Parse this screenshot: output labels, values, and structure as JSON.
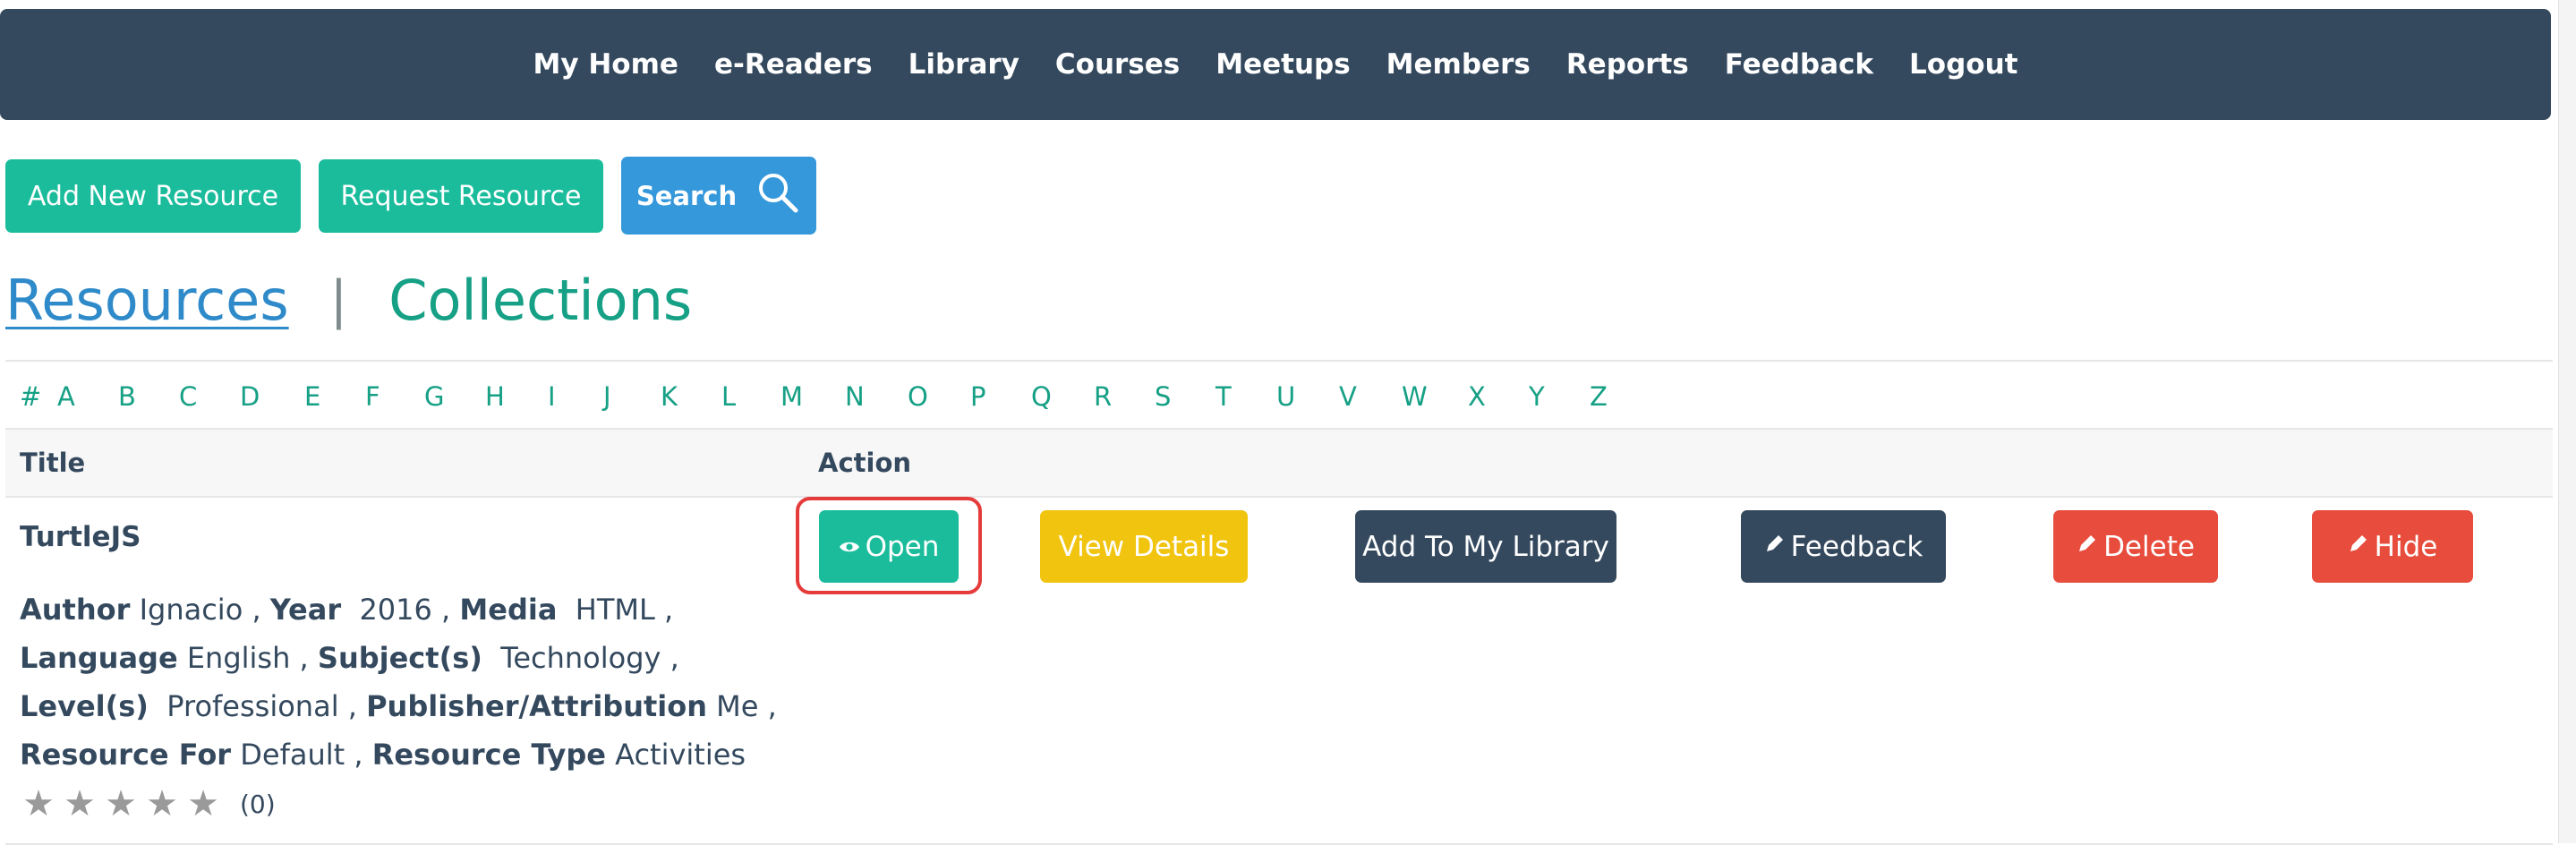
{
  "nav": {
    "items": [
      "My Home",
      "e-Readers",
      "Library",
      "Courses",
      "Meetups",
      "Members",
      "Reports",
      "Feedback",
      "Logout"
    ]
  },
  "toolbar": {
    "add_label": "Add New Resource",
    "request_label": "Request Resource",
    "search_label": "Search"
  },
  "tabs": {
    "resources": "Resources",
    "separator": "|",
    "collections": "Collections"
  },
  "alphabet": [
    "#",
    "A",
    "B",
    "C",
    "D",
    "E",
    "F",
    "G",
    "H",
    "I",
    "J",
    "K",
    "L",
    "M",
    "N",
    "O",
    "P",
    "Q",
    "R",
    "S",
    "T",
    "U",
    "V",
    "W",
    "X",
    "Y",
    "Z"
  ],
  "table": {
    "headers": {
      "title": "Title",
      "action": "Action"
    },
    "row": {
      "title": "TurtleJS",
      "meta": {
        "author_label": "Author",
        "author": "Ignacio",
        "year_label": "Year",
        "year": "2016",
        "media_label": "Media",
        "media": "HTML",
        "language_label": "Language",
        "language": "English",
        "subject_label": "Subject(s)",
        "subject": "Technology",
        "level_label": "Level(s)",
        "level": "Professional",
        "publisher_label": "Publisher/Attribution",
        "publisher": "Me",
        "resource_for_label": "Resource For",
        "resource_for": "Default",
        "resource_type_label": "Resource Type",
        "resource_type": "Activities"
      },
      "rating_count": "(0)",
      "rating_value": 0,
      "actions": {
        "open": "Open",
        "view_details": "View Details",
        "add_to_library": "Add To My Library",
        "feedback": "Feedback",
        "delete": "Delete",
        "hide": "Hide"
      }
    }
  },
  "colors": {
    "navbar": "#34495e",
    "teal": "#1abc9c",
    "blue": "#3498db",
    "yellow": "#f1c40f",
    "dark": "#34495e",
    "red": "#e74c3c",
    "highlight": "#e53b3b"
  }
}
